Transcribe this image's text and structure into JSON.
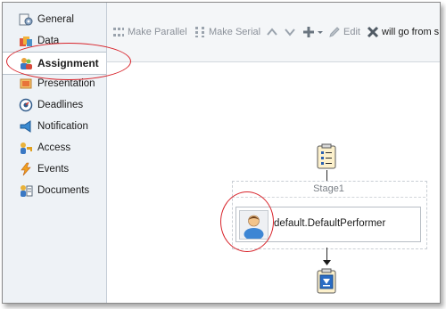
{
  "sidebar": {
    "items": [
      {
        "label": "General",
        "icon": "general-icon"
      },
      {
        "label": "Data",
        "icon": "data-icon"
      },
      {
        "label": "Assignment",
        "icon": "assignment-icon",
        "active": true
      },
      {
        "label": "Presentation",
        "icon": "presentation-icon"
      },
      {
        "label": "Deadlines",
        "icon": "deadlines-icon"
      },
      {
        "label": "Notification",
        "icon": "notification-icon"
      },
      {
        "label": "Access",
        "icon": "access-icon"
      },
      {
        "label": "Events",
        "icon": "events-icon"
      },
      {
        "label": "Documents",
        "icon": "documents-icon"
      }
    ]
  },
  "toolbar": {
    "make_parallel": "Make Parallel",
    "make_serial": "Make Serial",
    "edit": "Edit",
    "truncated_text": "will go from s"
  },
  "canvas": {
    "stage_title": "Stage1",
    "participant_label": "default.DefaultPerformer"
  },
  "colors": {
    "highlight": "#d8232a",
    "sidebar_bg": "#eef2f6"
  }
}
